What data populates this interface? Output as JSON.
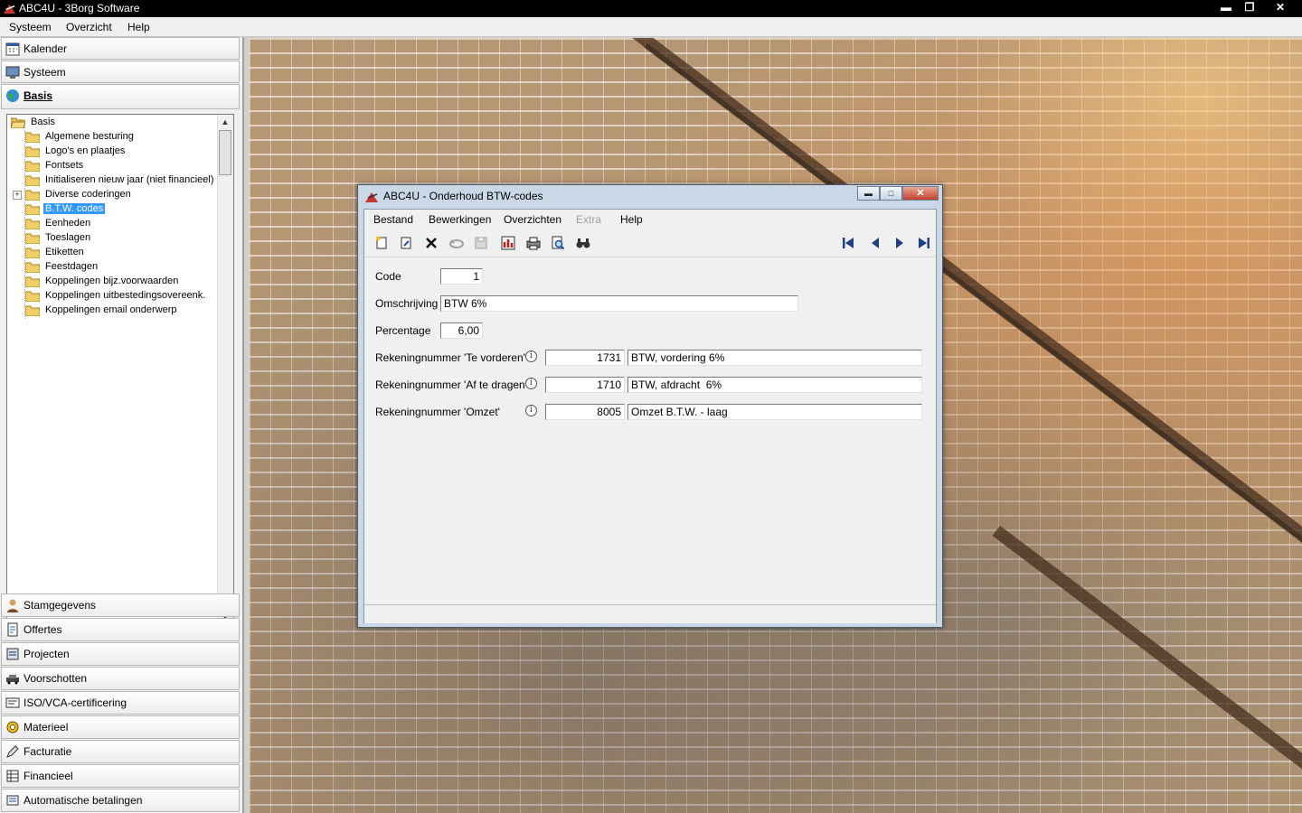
{
  "app": {
    "title": "ABC4U - 3Borg Software",
    "window_buttons": [
      "minimize",
      "restore",
      "close"
    ]
  },
  "menubar": {
    "items": [
      "Systeem",
      "Overzicht",
      "Help"
    ]
  },
  "sidebar": {
    "top_buttons": [
      {
        "label": "Kalender",
        "icon": "calendar-icon"
      },
      {
        "label": "Systeem",
        "icon": "monitor-icon"
      },
      {
        "label": "Basis",
        "icon": "globe-icon",
        "active": true
      }
    ],
    "tree": {
      "root": "Basis",
      "items": [
        "Algemene besturing",
        "Logo's en plaatjes",
        "Fontsets",
        "Initialiseren nieuw jaar (niet financieel)",
        "Diverse coderingen",
        "B.T.W. codes",
        "Eenheden",
        "Toeslagen",
        "Etiketten",
        "Feestdagen",
        "Koppelingen bijz.voorwaarden",
        "Koppelingen uitbestedingsovereenk.",
        "Koppelingen email onderwerp"
      ],
      "selected": "B.T.W. codes",
      "expandable": "Diverse coderingen"
    },
    "bottom_buttons": [
      {
        "label": "Stamgegevens",
        "icon": "person-icon"
      },
      {
        "label": "Offertes",
        "icon": "document-icon"
      },
      {
        "label": "Projecten",
        "icon": "project-icon"
      },
      {
        "label": "Voorschotten",
        "icon": "car-icon"
      },
      {
        "label": "ISO/VCA-certificering",
        "icon": "certificate-icon"
      },
      {
        "label": "Materieel",
        "icon": "gear-icon"
      },
      {
        "label": "Facturatie",
        "icon": "pencil-icon"
      },
      {
        "label": "Financieel",
        "icon": "ledger-icon"
      },
      {
        "label": "Automatische betalingen",
        "icon": "bank-icon"
      }
    ]
  },
  "dialog": {
    "title": "ABC4U - Onderhoud BTW-codes",
    "menu": [
      {
        "label": "Bestand",
        "enabled": true
      },
      {
        "label": "Bewerkingen",
        "enabled": true
      },
      {
        "label": "Overzichten",
        "enabled": true
      },
      {
        "label": "Extra",
        "enabled": false
      },
      {
        "label": "Help",
        "enabled": true
      }
    ],
    "toolbar_icons": [
      "new-icon",
      "edit-icon",
      "delete-icon",
      "undo-icon",
      "save-icon",
      "report-icon",
      "print-icon",
      "preview-icon",
      "find-icon"
    ],
    "nav_icons": [
      "first-record-icon",
      "previous-record-icon",
      "next-record-icon",
      "last-record-icon"
    ],
    "form": {
      "code_label": "Code",
      "code_value": "1",
      "omschrijving_label": "Omschrijving",
      "omschrijving_value": "BTW 6%",
      "percentage_label": "Percentage",
      "percentage_value": "6,00",
      "accounts": [
        {
          "label": "Rekeningnummer 'Te vorderen'",
          "number": "1731",
          "description": "BTW, vordering 6%"
        },
        {
          "label": "Rekeningnummer 'Af te dragen'",
          "number": "1710",
          "description": "BTW, afdracht  6%"
        },
        {
          "label": "Rekeningnummer 'Omzet'",
          "number": "8005",
          "description": "Omzet B.T.W. - laag"
        }
      ]
    }
  },
  "colors": {
    "titlebar": "#000000",
    "selection": "#3399ff",
    "dialog_frame": "#c9d7e6",
    "panel": "#f0f0f0",
    "brick": "#b59774"
  }
}
